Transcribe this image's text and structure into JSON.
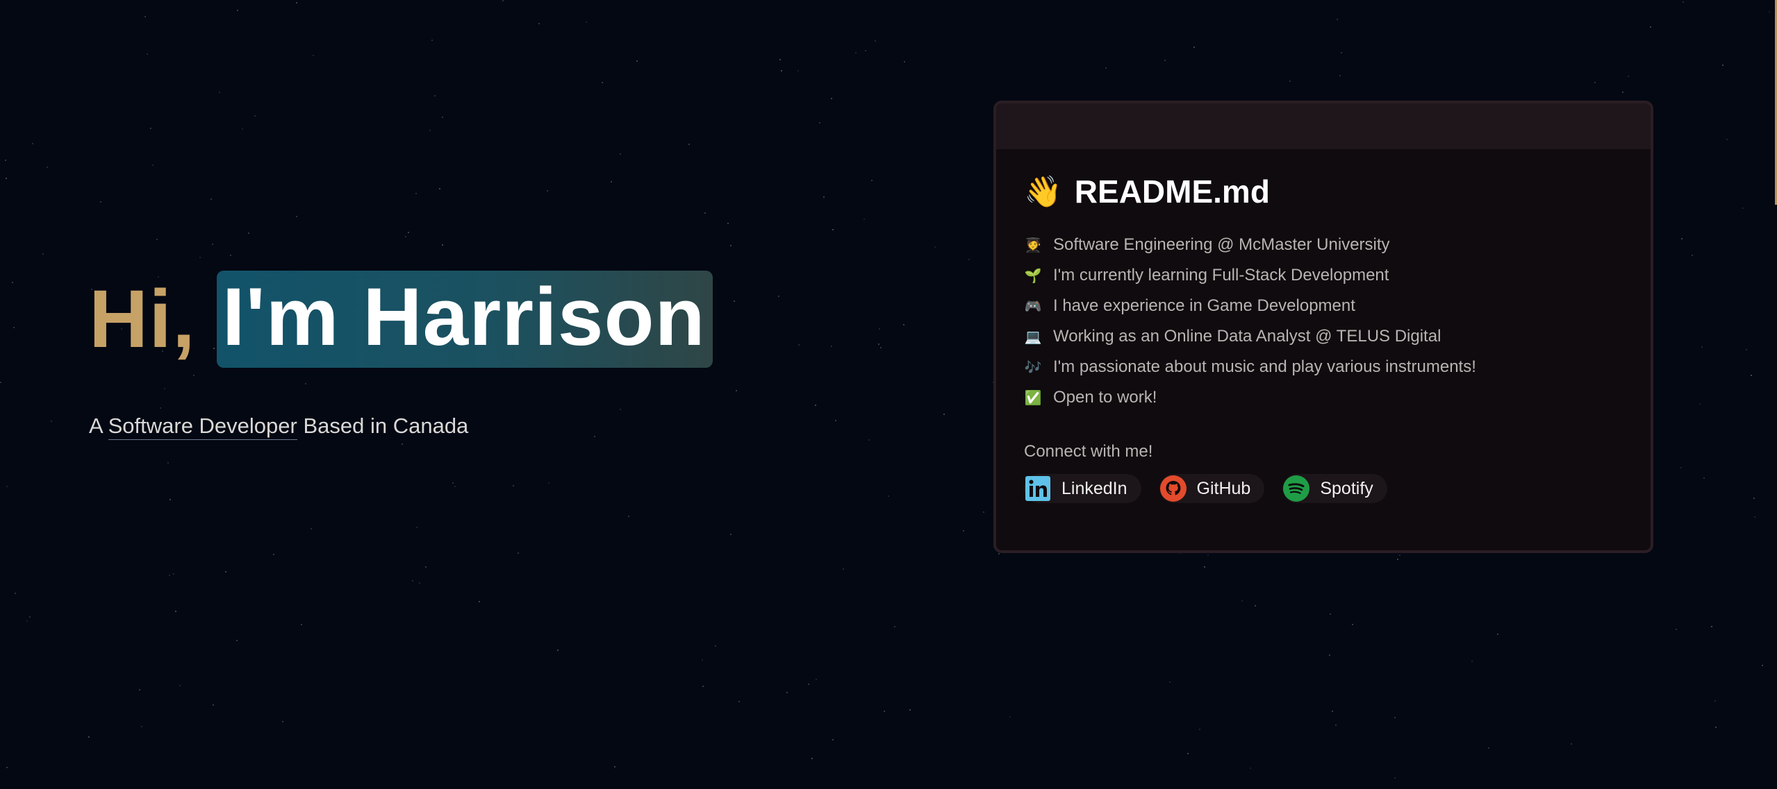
{
  "hero": {
    "greeting": "Hi,",
    "name": "I'm Harrison",
    "subtitle_prefix": "A ",
    "subtitle_highlight": "Software Developer",
    "subtitle_suffix": " Based in Canada"
  },
  "readme": {
    "title": "README.md",
    "title_icon": "waving-hand-icon",
    "lines": [
      {
        "icon": "student-icon",
        "glyph": "🧑‍🎓",
        "text": "Software Engineering @ McMaster University"
      },
      {
        "icon": "seedling-icon",
        "glyph": "🌱",
        "text": "I'm currently learning Full-Stack Development"
      },
      {
        "icon": "game-controller-icon",
        "glyph": "🎮",
        "text": "I have experience in Game Development"
      },
      {
        "icon": "laptop-icon",
        "glyph": "💻",
        "text": "Working as an Online Data Analyst @ TELUS Digital"
      },
      {
        "icon": "music-notes-icon",
        "glyph": "🎶",
        "text": "I'm passionate about music and play various instruments!"
      },
      {
        "icon": "check-mark-icon",
        "glyph": "✅",
        "text": "Open to work!"
      }
    ],
    "connect_label": "Connect with me!",
    "socials": [
      {
        "icon": "linkedin-icon",
        "label": "LinkedIn",
        "color": "#5fc2e8"
      },
      {
        "icon": "github-icon",
        "label": "GitHub",
        "color": "#e24b2b"
      },
      {
        "icon": "spotify-icon",
        "label": "Spotify",
        "color": "#1f9d46"
      }
    ]
  },
  "colors": {
    "background": "#040813",
    "greeting": "#c7a266",
    "name_pill_start": "#12536a",
    "name_pill_end": "#2f4646",
    "card_bg": "#0f0b0e",
    "card_border": "#2a1e24"
  }
}
